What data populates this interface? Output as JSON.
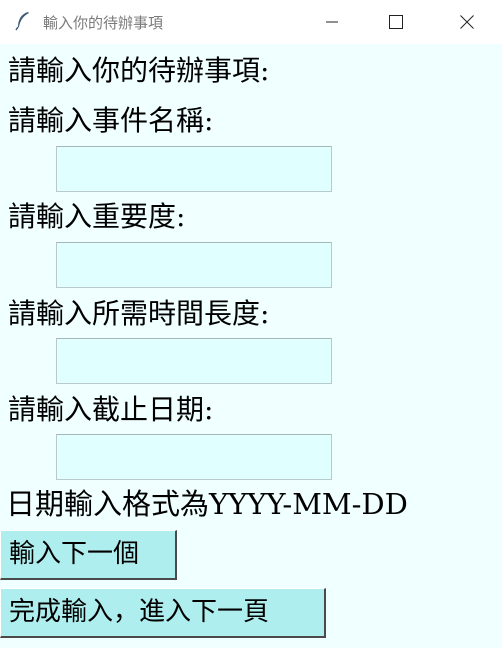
{
  "window": {
    "title": "輸入你的待辦事項"
  },
  "form": {
    "heading": "請輸入你的待辦事項:",
    "name_label": "請輸入事件名稱:",
    "name_value": "",
    "importance_label": "請輸入重要度:",
    "importance_value": "",
    "duration_label": "請輸入所需時間長度:",
    "duration_value": "",
    "deadline_label": "請輸入截止日期:",
    "deadline_value": "",
    "date_format_hint": "日期輸入格式為YYYY-MM-DD"
  },
  "buttons": {
    "next_item": "輸入下一個",
    "finish": "完成輸入，進入下一頁"
  },
  "colors": {
    "background": "#f0ffff",
    "field": "#e0ffff",
    "button": "#afeeee"
  }
}
